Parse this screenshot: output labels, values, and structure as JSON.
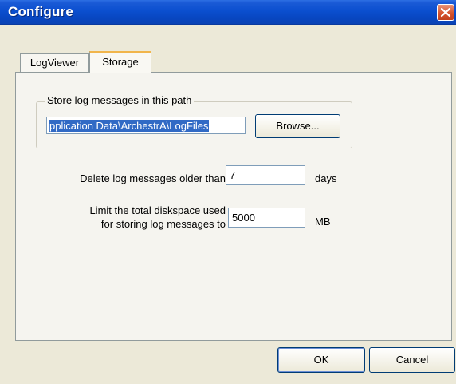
{
  "window": {
    "title": "Configure"
  },
  "tabs": [
    {
      "label": "LogViewer",
      "active": false
    },
    {
      "label": "Storage",
      "active": true
    }
  ],
  "storage": {
    "group_label": "Store log messages in this path",
    "path_value": "pplication Data\\ArchestrA\\LogFiles",
    "browse_label": "Browse...",
    "delete_label": "Delete log messages older than",
    "delete_value": "7",
    "delete_unit": "days",
    "limit_label_line1": "Limit the total diskspace used",
    "limit_label_line2": "for storing log messages to",
    "limit_value": "5000",
    "limit_unit": "MB"
  },
  "buttons": {
    "ok": "OK",
    "cancel": "Cancel"
  },
  "icons": {
    "close": "close-icon"
  },
  "colors": {
    "titlebar": "#0a4ecb",
    "selection": "#316ac5",
    "close_button": "#d5532e",
    "active_tab_accent": "#f1b54b"
  }
}
